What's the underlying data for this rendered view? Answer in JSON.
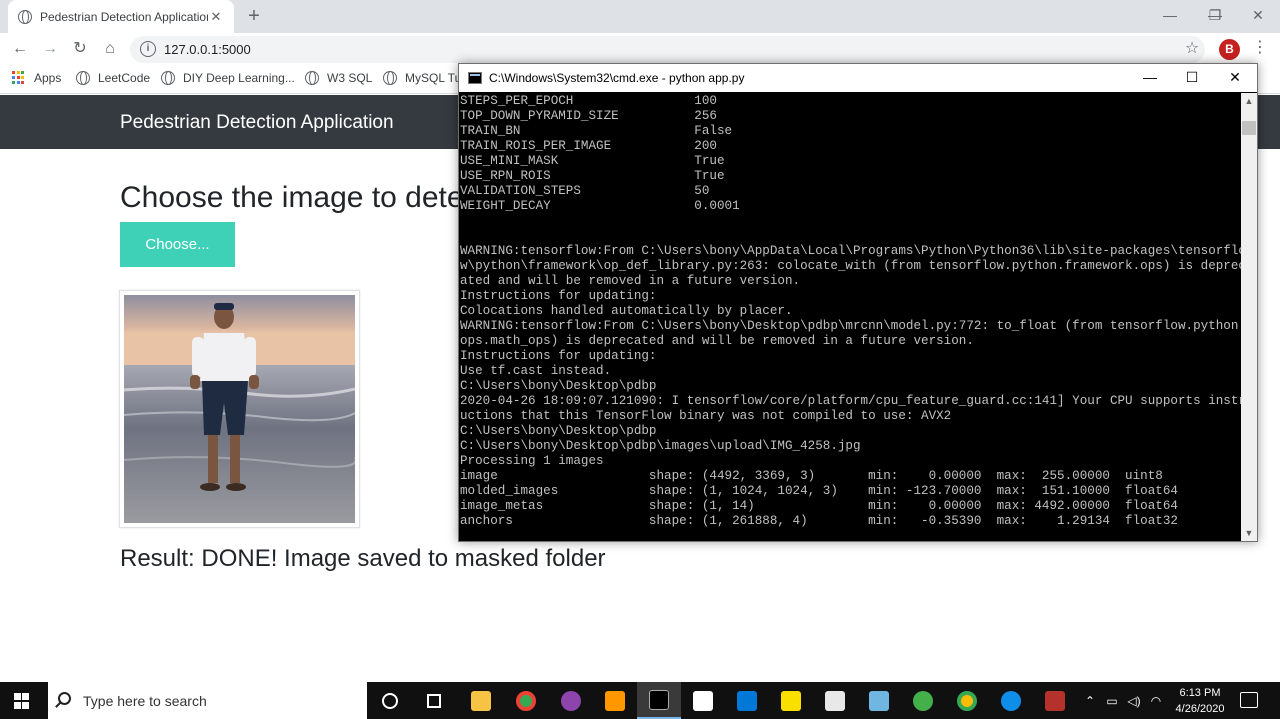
{
  "browser": {
    "tab_title": "Pedestrian Detection Application",
    "tab_close": "✕",
    "new_tab": "+",
    "url": "127.0.0.1:5000",
    "profile_initial": "B",
    "window_controls": [
      "—",
      "❐",
      "✕"
    ],
    "bookmarks": [
      "Apps",
      "LeetCode",
      "DIY Deep Learning...",
      "W3 SQL",
      "MySQL Tut"
    ]
  },
  "page": {
    "brand": "Pedestrian Detection Application",
    "heading": "Choose the image to detect",
    "choose_button": "Choose...",
    "result": "Result: DONE! Image saved to masked folder"
  },
  "cmd": {
    "title": "C:\\Windows\\System32\\cmd.exe - python  app.py",
    "controls": [
      "—",
      "☐",
      "✕"
    ],
    "lines": [
      "STEPS_PER_EPOCH                100",
      "TOP_DOWN_PYRAMID_SIZE          256",
      "TRAIN_BN                       False",
      "TRAIN_ROIS_PER_IMAGE           200",
      "USE_MINI_MASK                  True",
      "USE_RPN_ROIS                   True",
      "VALIDATION_STEPS               50",
      "WEIGHT_DECAY                   0.0001",
      "",
      "",
      "WARNING:tensorflow:From C:\\Users\\bony\\AppData\\Local\\Programs\\Python\\Python36\\lib\\site-packages\\tensorflo",
      "w\\python\\framework\\op_def_library.py:263: colocate_with (from tensorflow.python.framework.ops) is deprec",
      "ated and will be removed in a future version.",
      "Instructions for updating:",
      "Colocations handled automatically by placer.",
      "WARNING:tensorflow:From C:\\Users\\bony\\Desktop\\pdbp\\mrcnn\\model.py:772: to_float (from tensorflow.python.",
      "ops.math_ops) is deprecated and will be removed in a future version.",
      "Instructions for updating:",
      "Use tf.cast instead.",
      "C:\\Users\\bony\\Desktop\\pdbp",
      "2020-04-26 18:09:07.121090: I tensorflow/core/platform/cpu_feature_guard.cc:141] Your CPU supports instr",
      "uctions that this TensorFlow binary was not compiled to use: AVX2",
      "C:\\Users\\bony\\Desktop\\pdbp",
      "C:\\Users\\bony\\Desktop\\pdbp\\images\\upload\\IMG_4258.jpg",
      "Processing 1 images",
      "image                    shape: (4492, 3369, 3)       min:    0.00000  max:  255.00000  uint8",
      "molded_images            shape: (1, 1024, 1024, 3)    min: -123.70000  max:  151.10000  float64",
      "image_metas              shape: (1, 14)               min:    0.00000  max: 4492.00000  float64",
      "anchors                  shape: (1, 261888, 4)        min:   -0.35390  max:    1.29134  float32"
    ]
  },
  "taskbar": {
    "search_placeholder": "Type here to search",
    "time": "6:13 PM",
    "date": "4/26/2020"
  },
  "colors": {
    "navbar": "#343a40",
    "choose_button": "#3fd0b8",
    "profile": "#c5221f"
  }
}
